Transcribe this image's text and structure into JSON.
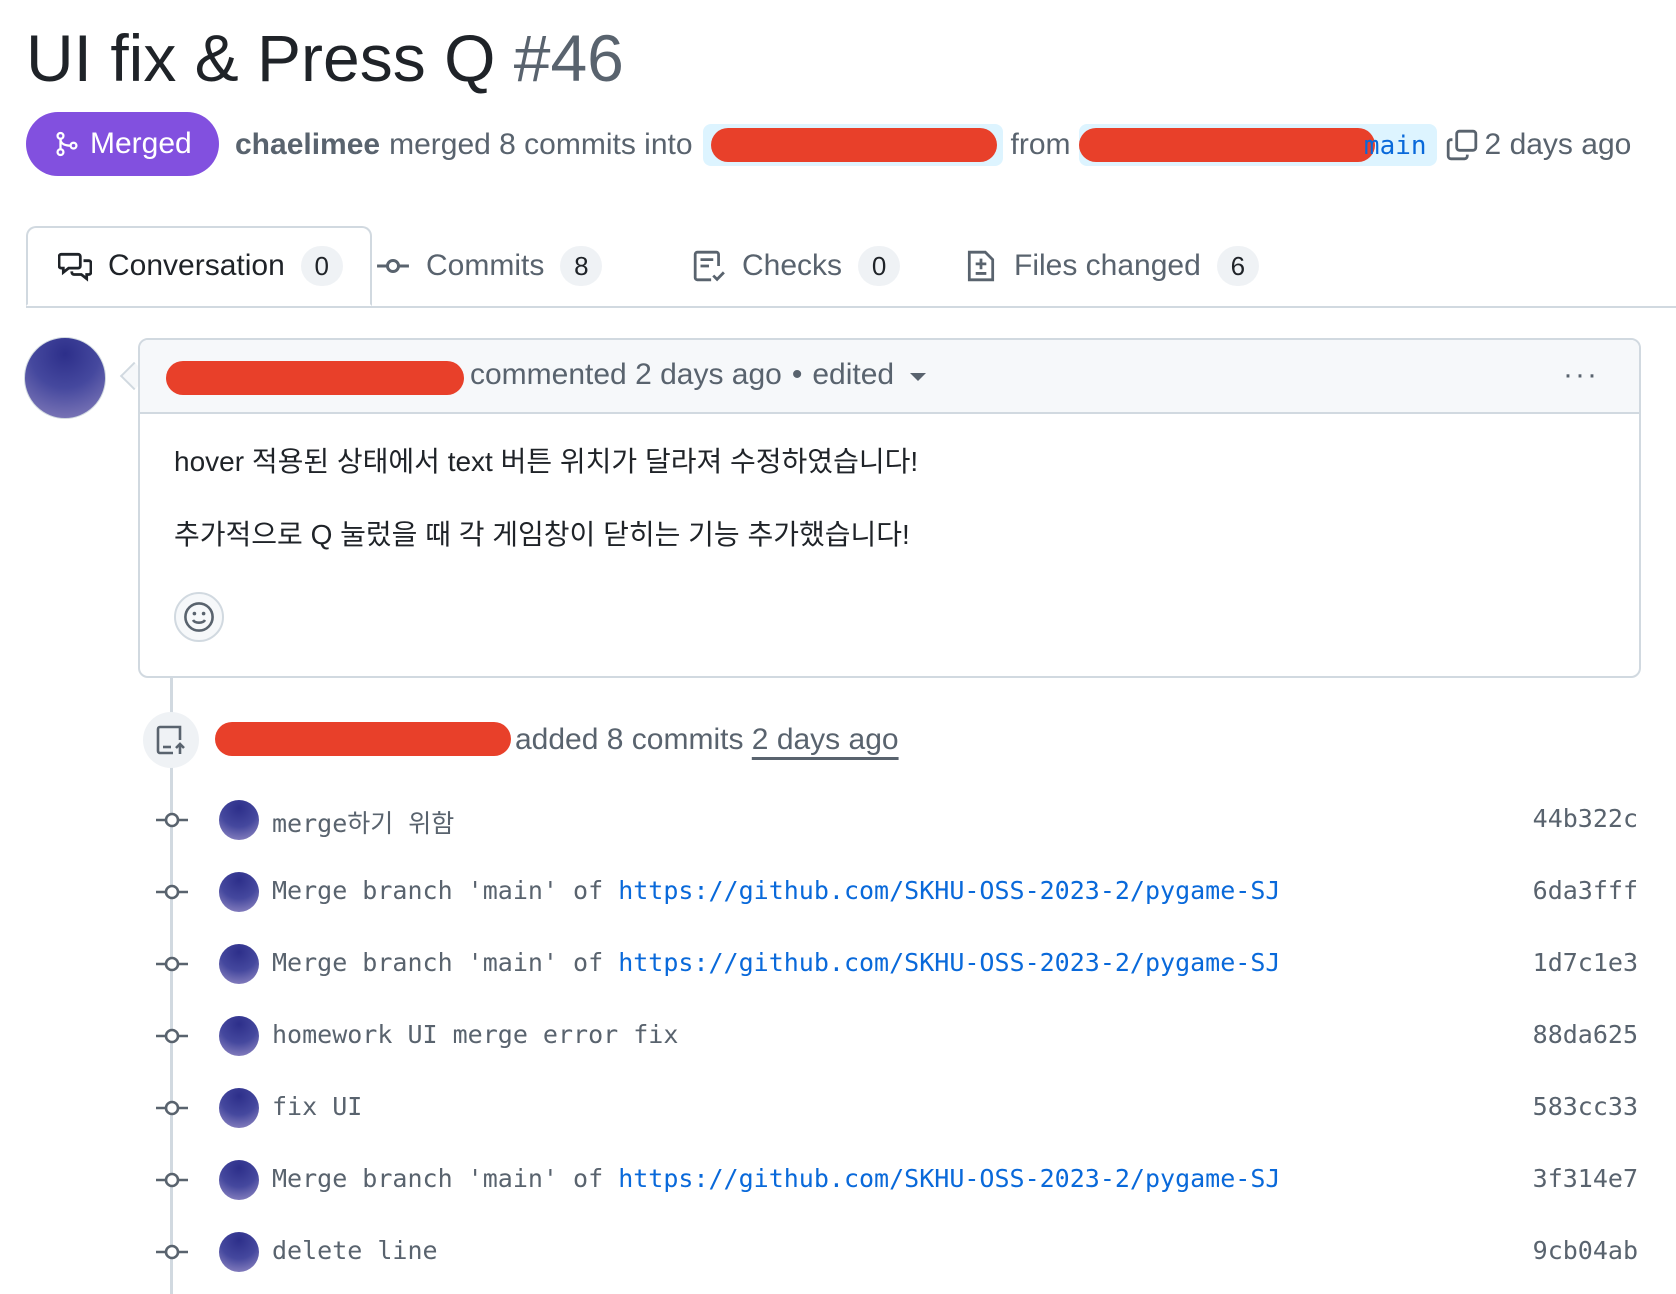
{
  "pr": {
    "title": "UI fix & Press Q",
    "number": "#46",
    "state_label": "Merged",
    "author": "chaelimee",
    "merge_text": "merged 8 commits into",
    "from_text": "from",
    "head_branch_tail": "main",
    "time": "2 days ago"
  },
  "tabs": [
    {
      "label": "Conversation",
      "count": "0"
    },
    {
      "label": "Commits",
      "count": "8"
    },
    {
      "label": "Checks",
      "count": "0"
    },
    {
      "label": "Files changed",
      "count": "6"
    }
  ],
  "comment": {
    "header_text": "commented 2 days ago",
    "separator": "•",
    "edited_label": "edited",
    "menu": "···",
    "body_line1": "hover 적용된 상태에서 text 버튼 위치가 달라져 수정하였습니다!",
    "body_line2": "추가적으로 Q 눌렀을 때 각 게임창이 닫히는 기능 추가했습니다!"
  },
  "push_event": {
    "text": "added 8 commits",
    "time": "2 days ago"
  },
  "commits": [
    {
      "message": "merge하기 위함",
      "link": "",
      "sha": "44b322c"
    },
    {
      "message": "Merge branch 'main' of ",
      "link": "https://github.com/SKHU-OSS-2023-2/pygame-SJ",
      "sha": "6da3fff"
    },
    {
      "message": "Merge branch 'main' of ",
      "link": "https://github.com/SKHU-OSS-2023-2/pygame-SJ",
      "sha": "1d7c1e3"
    },
    {
      "message": "homework UI merge error fix",
      "link": "",
      "sha": "88da625"
    },
    {
      "message": "fix UI",
      "link": "",
      "sha": "583cc33"
    },
    {
      "message": "Merge branch 'main' of ",
      "link": "https://github.com/SKHU-OSS-2023-2/pygame-SJ",
      "sha": "3f314e7"
    },
    {
      "message": "delete line",
      "link": "",
      "sha": "9cb04ab"
    }
  ],
  "colors": {
    "merged_purple": "#8250df",
    "link_blue": "#0969da",
    "redaction_red": "#e8402a",
    "branch_bg": "#ddf4ff"
  },
  "icons": [
    "git-merge-icon",
    "copy-icon",
    "comment-discussion-icon",
    "git-commit-icon",
    "checklist-icon",
    "file-diff-icon",
    "smiley-icon",
    "repo-push-icon"
  ]
}
